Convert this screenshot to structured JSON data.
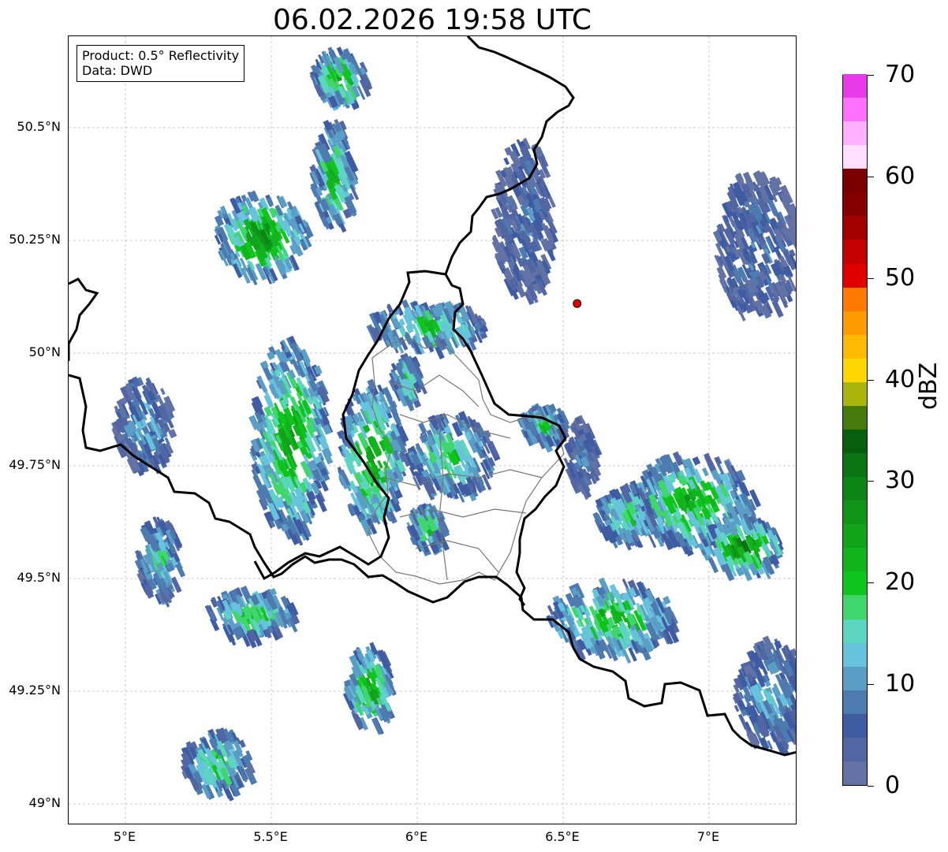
{
  "title": "06.02.2026 19:58 UTC",
  "info_box": {
    "product": "Product: 0.5° Reflectivity",
    "data": "Data: DWD"
  },
  "map": {
    "lon_range": [
      4.8,
      7.3
    ],
    "lat_range": [
      48.95,
      50.7
    ],
    "lat_ticks": [
      {
        "value": 50.5,
        "label": "50.5°N"
      },
      {
        "value": 50.25,
        "label": "50.25°N"
      },
      {
        "value": 50.0,
        "label": "50°N"
      },
      {
        "value": 49.75,
        "label": "49.75°N"
      },
      {
        "value": 49.5,
        "label": "49.5°N"
      },
      {
        "value": 49.25,
        "label": "49.25°N"
      },
      {
        "value": 49.0,
        "label": "49°N"
      }
    ],
    "lon_ticks": [
      {
        "value": 5.0,
        "label": "5°E"
      },
      {
        "value": 5.5,
        "label": "5.5°E"
      },
      {
        "value": 6.0,
        "label": "6°E"
      },
      {
        "value": 6.5,
        "label": "6.5°E"
      },
      {
        "value": 7.0,
        "label": "7°E"
      }
    ],
    "grid": true,
    "radar_site": {
      "lon": 6.548,
      "lat": 50.11,
      "color": "#e00000"
    },
    "precip_cells": [
      {
        "lon": 5.72,
        "lat": 50.62,
        "rx": 0.09,
        "ry": 0.06,
        "level": 25
      },
      {
        "lon": 5.45,
        "lat": 50.27,
        "rx": 0.16,
        "ry": 0.09,
        "level": 28
      },
      {
        "lon": 5.7,
        "lat": 50.4,
        "rx": 0.07,
        "ry": 0.12,
        "level": 22
      },
      {
        "lon": 5.55,
        "lat": 49.82,
        "rx": 0.13,
        "ry": 0.22,
        "level": 26
      },
      {
        "lon": 5.83,
        "lat": 49.78,
        "rx": 0.11,
        "ry": 0.16,
        "level": 27
      },
      {
        "lon": 6.65,
        "lat": 49.42,
        "rx": 0.22,
        "ry": 0.08,
        "level": 24
      },
      {
        "lon": 6.92,
        "lat": 49.68,
        "rx": 0.22,
        "ry": 0.1,
        "level": 24
      },
      {
        "lon": 7.1,
        "lat": 49.58,
        "rx": 0.14,
        "ry": 0.06,
        "level": 30
      },
      {
        "lon": 5.82,
        "lat": 49.27,
        "rx": 0.08,
        "ry": 0.09,
        "level": 26
      },
      {
        "lon": 5.42,
        "lat": 49.43,
        "rx": 0.15,
        "ry": 0.05,
        "level": 22
      },
      {
        "lon": 6.1,
        "lat": 49.78,
        "rx": 0.15,
        "ry": 0.09,
        "level": 20
      },
      {
        "lon": 6.02,
        "lat": 50.07,
        "rx": 0.2,
        "ry": 0.05,
        "level": 21
      },
      {
        "lon": 7.15,
        "lat": 50.25,
        "rx": 0.14,
        "ry": 0.16,
        "level": 8
      },
      {
        "lon": 6.7,
        "lat": 49.65,
        "rx": 0.1,
        "ry": 0.06,
        "level": 20
      },
      {
        "lon": 5.05,
        "lat": 49.85,
        "rx": 0.1,
        "ry": 0.1,
        "level": 12
      },
      {
        "lon": 5.1,
        "lat": 49.55,
        "rx": 0.07,
        "ry": 0.09,
        "level": 18
      },
      {
        "lon": 5.3,
        "lat": 49.1,
        "rx": 0.12,
        "ry": 0.07,
        "level": 20
      },
      {
        "lon": 6.35,
        "lat": 50.3,
        "rx": 0.1,
        "ry": 0.18,
        "level": 8
      },
      {
        "lon": 7.2,
        "lat": 49.25,
        "rx": 0.12,
        "ry": 0.12,
        "level": 14
      },
      {
        "lon": 5.95,
        "lat": 49.95,
        "rx": 0.05,
        "ry": 0.05,
        "level": 20
      },
      {
        "lon": 6.42,
        "lat": 49.85,
        "rx": 0.08,
        "ry": 0.04,
        "level": 20
      },
      {
        "lon": 6.55,
        "lat": 49.78,
        "rx": 0.05,
        "ry": 0.08,
        "level": 8
      },
      {
        "lon": 6.02,
        "lat": 49.62,
        "rx": 0.06,
        "ry": 0.05,
        "level": 22
      }
    ]
  },
  "colorbar": {
    "unit": "dBZ",
    "range": [
      0,
      70
    ],
    "colors": [
      "#6272a5",
      "#5266a3",
      "#3f5ca3",
      "#4d7bb0",
      "#5a9ec5",
      "#67c2dd",
      "#5cd6c1",
      "#3fd66e",
      "#10c41e",
      "#11b41c",
      "#11a41a",
      "#0f9418",
      "#0c8416",
      "#0a7412",
      "#075f0e",
      "#477a0d",
      "#a9b50a",
      "#fdd700",
      "#fdbb00",
      "#fe9b00",
      "#fe7a00",
      "#e00000",
      "#c40000",
      "#a40000",
      "#840000",
      "#7a0000",
      "#ffdeff",
      "#ffb0ff",
      "#ff70ff",
      "#e83ae8"
    ],
    "ticks": [
      {
        "value": 0,
        "label": "0"
      },
      {
        "value": 10,
        "label": "10"
      },
      {
        "value": 20,
        "label": "20"
      },
      {
        "value": 30,
        "label": "30"
      },
      {
        "value": 40,
        "label": "40"
      },
      {
        "value": 50,
        "label": "50"
      },
      {
        "value": 60,
        "label": "60"
      },
      {
        "value": 70,
        "label": "70"
      }
    ]
  }
}
